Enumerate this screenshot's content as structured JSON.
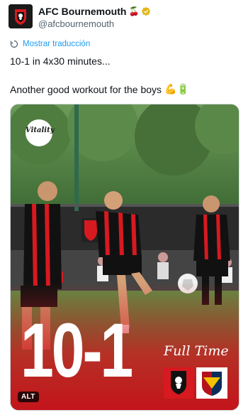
{
  "account": {
    "display_name": "AFC Bournemouth",
    "handle": "@afcbournemouth",
    "name_emoji": "🍒"
  },
  "translate": {
    "label": "Mostrar traducción"
  },
  "tweet": {
    "line1": "10-1 in 4x30 minutes...",
    "line2": "Another good workout for the boys",
    "line2_emojis": "💪🔋"
  },
  "media": {
    "sponsor_logo": "Vitality",
    "score": "10-1",
    "full_time": "Full Time",
    "alt_label": "ALT",
    "colors": {
      "red": "#d71920",
      "black": "#111111",
      "pitch": "#4f7a3a"
    }
  }
}
